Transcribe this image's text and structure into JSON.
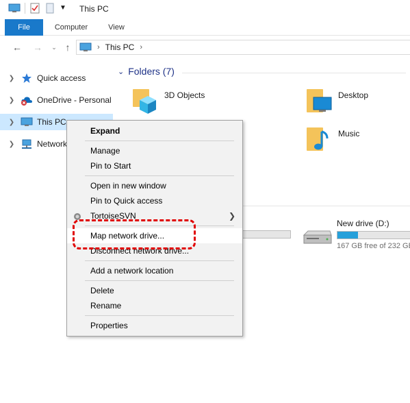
{
  "window": {
    "title": "This PC"
  },
  "ribbon": {
    "tabs": [
      {
        "label": "File"
      },
      {
        "label": "Computer"
      },
      {
        "label": "View"
      }
    ]
  },
  "address": {
    "path": [
      "This PC"
    ]
  },
  "navpane": {
    "items": [
      {
        "label": "Quick access",
        "icon": "star-icon"
      },
      {
        "label": "OneDrive - Personal",
        "icon": "cloud-icon"
      },
      {
        "label": "This PC",
        "icon": "computer-icon",
        "selected": true
      },
      {
        "label": "Network",
        "icon": "network-icon"
      }
    ]
  },
  "content": {
    "folders_header": "Folders (7)",
    "folders": [
      {
        "label": "3D Objects",
        "icon": "3d-objects-icon"
      },
      {
        "label": "Desktop",
        "icon": "desktop-folder-icon"
      },
      {
        "label": "Music",
        "icon": "music-folder-icon"
      }
    ],
    "drive": {
      "label": "New drive (D:)",
      "free_text": "167 GB free of 232 GB",
      "used_fraction": 0.28
    },
    "partial_drive_used_fraction": 0.0
  },
  "context_menu": {
    "items": [
      {
        "label": "Expand",
        "bold": true
      },
      {
        "label": "Manage"
      },
      {
        "label": "Pin to Start"
      },
      {
        "label": "Open in new window"
      },
      {
        "label": "Pin to Quick access"
      },
      {
        "label": "TortoiseSVN",
        "submenu": true
      },
      {
        "label": "Map network drive...",
        "highlighted": true
      },
      {
        "label": "Disconnect network drive..."
      },
      {
        "label": "Add a network location"
      },
      {
        "label": "Delete"
      },
      {
        "label": "Rename"
      },
      {
        "label": "Properties"
      }
    ]
  },
  "colors": {
    "accent": "#1979ca",
    "selection": "#cce8ff",
    "highlight": "#e00000",
    "folder": "#f4c35a"
  }
}
